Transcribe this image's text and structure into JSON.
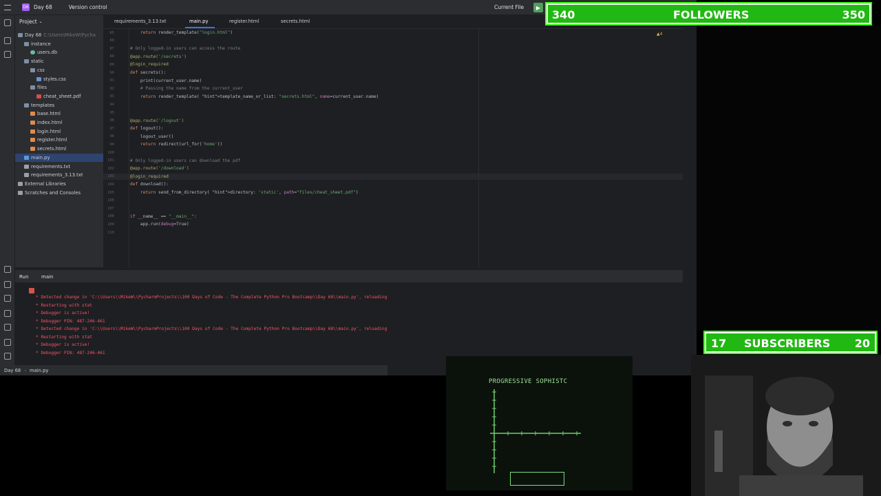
{
  "topbar": {
    "project_badge": "D6",
    "project_name": "Day 68",
    "version_control": "Version control",
    "current_file": "Current File"
  },
  "project_panel": {
    "title": "Project",
    "tree": [
      {
        "label": "Day 68",
        "suffix": "C:\\Users\\MikeW\\Pycha",
        "icon": "folder-icon",
        "depth": 0
      },
      {
        "label": "instance",
        "icon": "folder-icon",
        "depth": 1
      },
      {
        "label": "users.db",
        "icon": "database-icon",
        "depth": 2
      },
      {
        "label": "static",
        "icon": "folder-icon",
        "depth": 1
      },
      {
        "label": "css",
        "icon": "folder-icon",
        "depth": 2
      },
      {
        "label": "styles.css",
        "icon": "css-file-icon",
        "depth": 3
      },
      {
        "label": "files",
        "icon": "folder-icon",
        "depth": 2
      },
      {
        "label": "cheat_sheet.pdf",
        "icon": "pdf-file-icon",
        "depth": 3
      },
      {
        "label": "templates",
        "icon": "folder-icon",
        "depth": 1
      },
      {
        "label": "base.html",
        "icon": "html-file-icon",
        "depth": 2
      },
      {
        "label": "index.html",
        "icon": "html-file-icon",
        "depth": 2
      },
      {
        "label": "login.html",
        "icon": "html-file-icon",
        "depth": 2
      },
      {
        "label": "register.html",
        "icon": "html-file-icon",
        "depth": 2
      },
      {
        "label": "secrets.html",
        "icon": "html-file-icon",
        "depth": 2
      },
      {
        "label": "main.py",
        "icon": "python-file-icon",
        "depth": 1,
        "selected": true
      },
      {
        "label": "requirements.txt",
        "icon": "text-file-icon",
        "depth": 1
      },
      {
        "label": "requirements_3.13.txt",
        "icon": "text-file-icon",
        "depth": 1
      },
      {
        "label": "External Libraries",
        "icon": "library-icon",
        "depth": 0
      },
      {
        "label": "Scratches and Consoles",
        "icon": "scratch-icon",
        "depth": 0
      }
    ]
  },
  "editor": {
    "tabs": [
      {
        "label": "requirements_3.13.txt",
        "active": false
      },
      {
        "label": "main.py",
        "active": true
      },
      {
        "label": "register.html",
        "active": false
      },
      {
        "label": "secrets.html",
        "active": false
      }
    ],
    "warning_count": "4",
    "lines": [
      {
        "n": "85",
        "code": "    return render_template(\"login.html\")"
      },
      {
        "n": "86",
        "code": ""
      },
      {
        "n": "87",
        "code": "# Only logged-in users can access the route"
      },
      {
        "n": "88",
        "code": "@app.route('/secrets')"
      },
      {
        "n": "89",
        "code": "@login_required"
      },
      {
        "n": "90",
        "code": "def secrets():"
      },
      {
        "n": "91",
        "code": "    print(current_user.name)"
      },
      {
        "n": "92",
        "code": "    # Passing the name from the current_user"
      },
      {
        "n": "93",
        "code": "    return render_template( template_name_or_list: \"secrets.html\", name=current_user.name)"
      },
      {
        "n": "94",
        "code": ""
      },
      {
        "n": "95",
        "code": ""
      },
      {
        "n": "96",
        "code": "@app.route('/logout')"
      },
      {
        "n": "97",
        "code": "def logout():"
      },
      {
        "n": "98",
        "code": "    logout_user()"
      },
      {
        "n": "99",
        "code": "    return redirect(url_for('home'))"
      },
      {
        "n": "100",
        "code": ""
      },
      {
        "n": "101",
        "code": "# Only logged-in users can download the pdf"
      },
      {
        "n": "102",
        "code": "@app.route('/download')"
      },
      {
        "n": "103",
        "code": "@login_required"
      },
      {
        "n": "104",
        "code": "def download():"
      },
      {
        "n": "105",
        "code": "    return send_from_directory( directory: 'static', path=\"files/cheat_sheet.pdf\")"
      },
      {
        "n": "106",
        "code": ""
      },
      {
        "n": "107",
        "code": ""
      },
      {
        "n": "108",
        "code": "if __name__ == \"__main__\":"
      },
      {
        "n": "109",
        "code": "    app.run(debug=True)"
      },
      {
        "n": "110",
        "code": ""
      }
    ]
  },
  "run_panel": {
    "title": "Run",
    "tab": "main",
    "output": [
      "* Detected change in 'C:\\\\Users\\\\MikeW\\\\PycharmProjects\\\\100 Days of Code - The Complete Python Pro Bootcamp\\\\Day 68\\\\main.py', reloading",
      "* Restarting with stat",
      "* Debugger is active!",
      "* Debugger PIN: 487-246-461",
      "* Detected change in 'C:\\\\Users\\\\MikeW\\\\PycharmProjects\\\\100 Days of Code - The Complete Python Pro Bootcamp\\\\Day 68\\\\main.py', reloading",
      "* Restarting with stat",
      "* Debugger is active!",
      "* Debugger PIN: 487-246-461"
    ]
  },
  "statusbar": {
    "project": "Day 68",
    "file": "main.py"
  },
  "overlay": {
    "followers": {
      "current": "340",
      "label": "FOLLOWERS",
      "goal": "350"
    },
    "subscribers": {
      "current": "17",
      "label": "SUBSCRIBERS",
      "goal": "20"
    },
    "retro_title": "PROGRESSIVE  SOPHISTC",
    "colors": {
      "banner_green": "#22b814",
      "banner_border": "#39ff14",
      "crt_green": "#9ee39a"
    }
  }
}
